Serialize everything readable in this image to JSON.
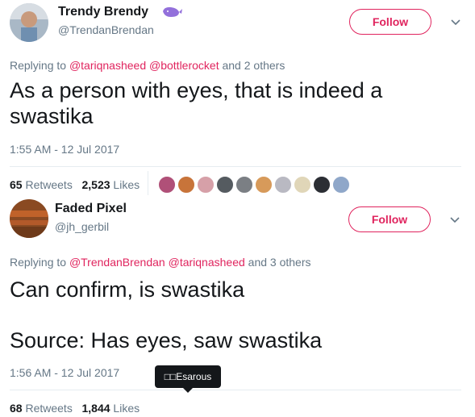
{
  "tweet1": {
    "display_name": "Trendy Brendy",
    "handle": "@TrendanBrendan",
    "badge_icon": "whale-icon",
    "follow_label": "Follow",
    "replying_prefix": "Replying to ",
    "mention_1": "@tariqnasheed",
    "mention_2": "@bottlerocket",
    "replying_suffix": " and 2 others",
    "text_line_1": "As a person with eyes, that is indeed a",
    "text_line_2": "swastika",
    "timestamp": "1:55 AM - 12 Jul 2017",
    "retweets_count": "65",
    "retweets_label": " Retweets",
    "likes_count": "2,523",
    "likes_label": " Likes"
  },
  "tweet2": {
    "display_name": "Faded Pixel",
    "handle": "@jh_gerbil",
    "follow_label": "Follow",
    "replying_prefix": "Replying to ",
    "mention_1": "@TrendanBrendan",
    "mention_2": "@tariqnasheed",
    "replying_suffix": " and 3 others",
    "text_line_1": "Can confirm, is swastika",
    "text_line_2": "Source: Has eyes, saw swastika",
    "timestamp": "1:56 AM - 12 Jul 2017",
    "retweets_count": "68",
    "retweets_label": " Retweets",
    "likes_count": "1,844",
    "likes_label": " Likes"
  },
  "tooltip": {
    "text": "□□Esarous"
  },
  "colors": {
    "accent": "#e0245e",
    "secondary_text": "#657786",
    "primary_text": "#14171a",
    "divider": "#e6ecf0"
  }
}
